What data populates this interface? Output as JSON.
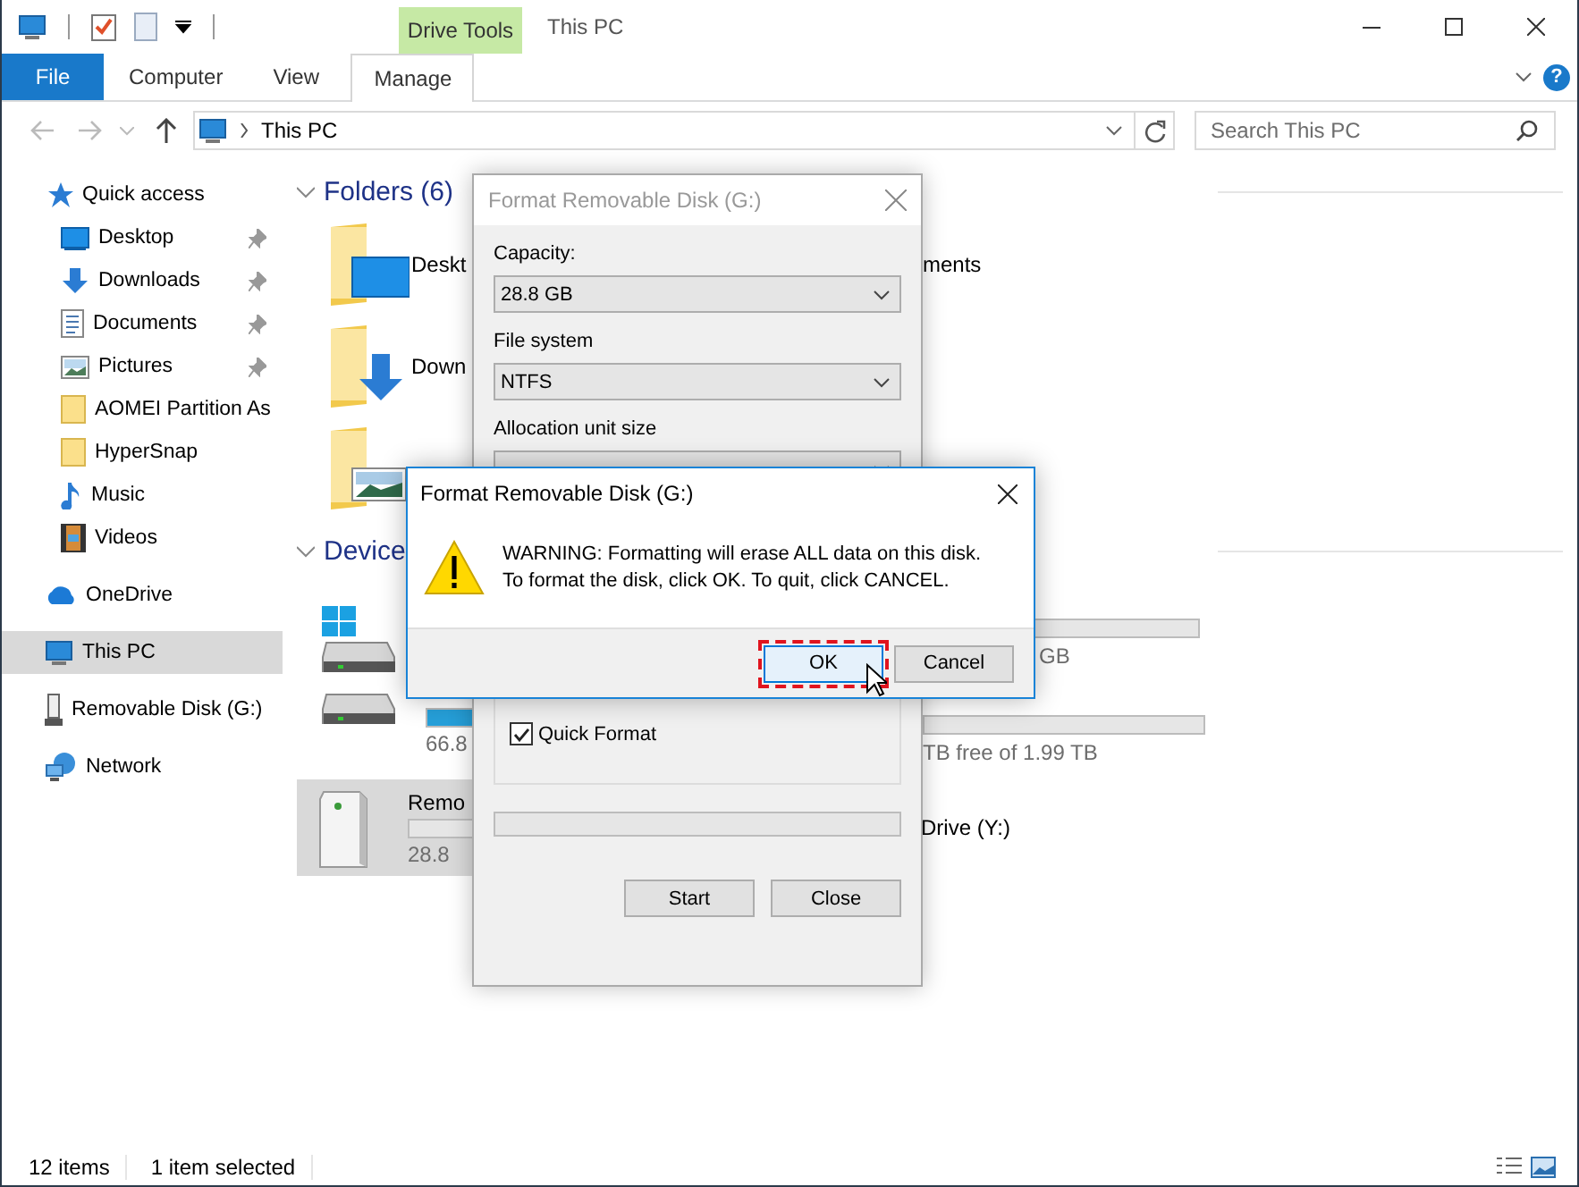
{
  "window": {
    "title": "This PC",
    "context_tab": "Drive Tools"
  },
  "ribbon": {
    "tabs": [
      {
        "label": "File",
        "kind": "file",
        "selected": false
      },
      {
        "label": "Computer",
        "kind": "tab",
        "selected": false
      },
      {
        "label": "View",
        "kind": "tab",
        "selected": false
      },
      {
        "label": "Manage",
        "kind": "contextual",
        "selected": true
      }
    ],
    "help": "?"
  },
  "address": {
    "path": "This PC"
  },
  "search": {
    "placeholder": "Search This PC"
  },
  "sidebar": {
    "items": [
      {
        "label": "Quick access",
        "kind": "star",
        "selected": false,
        "children": [
          {
            "label": "Desktop",
            "kind": "desktop",
            "pinned": true,
            "selected": false
          },
          {
            "label": "Downloads",
            "kind": "downloads",
            "pinned": true,
            "selected": false
          },
          {
            "label": "Documents",
            "kind": "documents",
            "pinned": true,
            "selected": false
          },
          {
            "label": "Pictures",
            "kind": "pictures",
            "pinned": true,
            "selected": false
          },
          {
            "label": "AOMEI Partition As",
            "kind": "folder",
            "pinned": false,
            "selected": false
          },
          {
            "label": "HyperSnap",
            "kind": "folder",
            "pinned": false,
            "selected": false
          },
          {
            "label": "Music",
            "kind": "music",
            "pinned": false,
            "selected": false
          },
          {
            "label": "Videos",
            "kind": "videos",
            "pinned": false,
            "selected": false
          }
        ]
      },
      {
        "label": "OneDrive",
        "kind": "cloud",
        "selected": false
      },
      {
        "label": "This PC",
        "kind": "pc",
        "selected": true
      },
      {
        "label": "Removable Disk (G:)",
        "kind": "usb",
        "selected": false
      },
      {
        "label": "Network",
        "kind": "network",
        "selected": false
      }
    ]
  },
  "folders": {
    "title": "Folders (6)",
    "expanded": true,
    "items": [
      {
        "kind": "desktop",
        "name": "Deskt",
        "neighbor_text": "ments"
      },
      {
        "kind": "downloads",
        "name": "Down"
      },
      {
        "kind": "pictures"
      }
    ]
  },
  "devices": {
    "title": "Device",
    "expanded": true,
    "items": [
      {
        "kind": "system-drive",
        "selected": false,
        "neighbor": {
          "text": "GB",
          "kind": "tail"
        }
      },
      {
        "kind": "drive",
        "selected": false,
        "level": 0.3,
        "size": "66.8",
        "neighbor": {
          "text": "TB free of 1.99 TB",
          "kind": "full"
        }
      },
      {
        "kind": "usb-drive",
        "selected": true,
        "name": "Remo",
        "level": 0,
        "size": "28.8",
        "neighbor": {
          "text": "Drive (Y:)",
          "kind": "name"
        }
      }
    ]
  },
  "status_bar": {
    "items": [
      "12 items",
      "1 item selected"
    ]
  },
  "format_dialog": {
    "title": "Format Removable Disk (G:)",
    "active": false,
    "fields": [
      {
        "label": "Capacity:",
        "value": "28.8 GB"
      },
      {
        "label": "File system",
        "value": "NTFS"
      },
      {
        "label": "Allocation unit size"
      }
    ],
    "quick_format": {
      "label": "Quick Format",
      "checked": true
    },
    "progress": {
      "level": 0
    },
    "buttons": [
      "Start",
      "Close"
    ]
  },
  "alert": {
    "title": "Format Removable Disk (G:)",
    "kind": "warning",
    "message_lines": [
      "WARNING: Formatting will erase ALL data on this disk.",
      "To format the disk, click OK. To quit, click CANCEL."
    ],
    "buttons": [
      {
        "label": "OK",
        "focused": true
      },
      {
        "label": "Cancel",
        "focused": false
      }
    ]
  }
}
